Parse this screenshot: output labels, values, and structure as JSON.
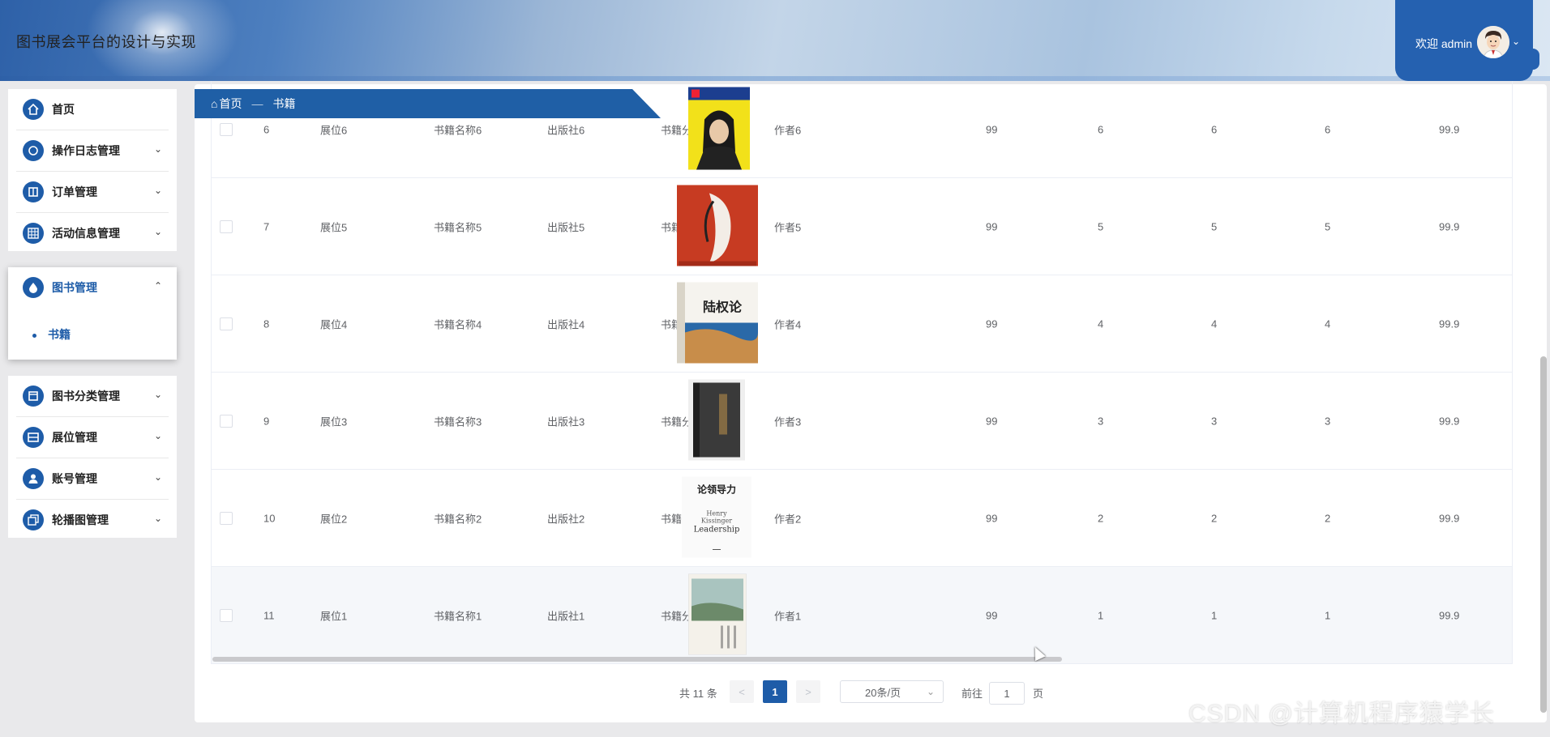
{
  "header": {
    "site_title": "图书展会平台的设计与实现",
    "welcome": "欢迎 admin",
    "avatar": "avatar-icon"
  },
  "sidebar": {
    "items": [
      {
        "label": "首页",
        "icon": "home-icon"
      },
      {
        "label": "操作日志管理",
        "icon": "log-icon"
      },
      {
        "label": "订单管理",
        "icon": "order-icon"
      },
      {
        "label": "活动信息管理",
        "icon": "grid-icon"
      },
      {
        "label": "图书管理",
        "icon": "drop-icon",
        "expanded": true,
        "children": [
          {
            "label": "书籍"
          }
        ]
      },
      {
        "label": "图书分类管理",
        "icon": "category-icon"
      },
      {
        "label": "展位管理",
        "icon": "booth-icon"
      },
      {
        "label": "账号管理",
        "icon": "user-icon"
      },
      {
        "label": "轮播图管理",
        "icon": "carousel-icon"
      }
    ]
  },
  "breadcrumb": {
    "home": "首页",
    "sep": "—",
    "current": "书籍"
  },
  "table": {
    "rows": [
      {
        "idx": "6",
        "booth": "展位6",
        "name": "书籍名称6",
        "publisher": "出版社6",
        "category": "书籍分类6",
        "author": "作者6",
        "cover": "magazine-cover",
        "c1": "99",
        "c2": "6",
        "c3": "6",
        "c4": "6",
        "price": "99.9"
      },
      {
        "idx": "7",
        "booth": "展位5",
        "name": "书籍名称5",
        "publisher": "出版社5",
        "category": "书籍分类5",
        "author": "作者5",
        "cover": "red-portrait-cover",
        "c1": "99",
        "c2": "5",
        "c3": "5",
        "c4": "5",
        "price": "99.9"
      },
      {
        "idx": "8",
        "booth": "展位4",
        "name": "书籍名称4",
        "publisher": "出版社4",
        "category": "书籍分类4",
        "author": "作者4",
        "cover": "landpower-cover",
        "c1": "99",
        "c2": "4",
        "c3": "4",
        "c4": "4",
        "price": "99.9"
      },
      {
        "idx": "9",
        "booth": "展位3",
        "name": "书籍名称3",
        "publisher": "出版社3",
        "category": "书籍分类3",
        "author": "作者3",
        "cover": "dark-book-cover",
        "c1": "99",
        "c2": "3",
        "c3": "3",
        "c4": "3",
        "price": "99.9"
      },
      {
        "idx": "10",
        "booth": "展位2",
        "name": "书籍名称2",
        "publisher": "出版社2",
        "category": "书籍分类2",
        "author": "作者2",
        "cover": "leadership-cover",
        "c1": "99",
        "c2": "2",
        "c3": "2",
        "c4": "2",
        "price": "99.9"
      },
      {
        "idx": "11",
        "booth": "展位1",
        "name": "书籍名称1",
        "publisher": "出版社1",
        "category": "书籍分类1",
        "author": "作者1",
        "cover": "landscape-cover",
        "c1": "99",
        "c2": "1",
        "c3": "1",
        "c4": "1",
        "price": "99.9"
      }
    ],
    "cover_texts": {
      "landpower": "陆权论",
      "leadership_cn": "论领导力",
      "leadership_en1": "Henry",
      "leadership_en2": "Kissinger",
      "leadership_en3": "Leadership"
    }
  },
  "pagination": {
    "total": "共 11 条",
    "prev": "<",
    "page": "1",
    "next": ">",
    "page_size": "20条/页",
    "goto_prefix": "前往",
    "goto_value": "1",
    "goto_suffix": "页"
  },
  "watermark": "CSDN @计算机程序猿学长",
  "colors": {
    "primary": "#1e5ca8",
    "header_band": "#2561b0"
  }
}
